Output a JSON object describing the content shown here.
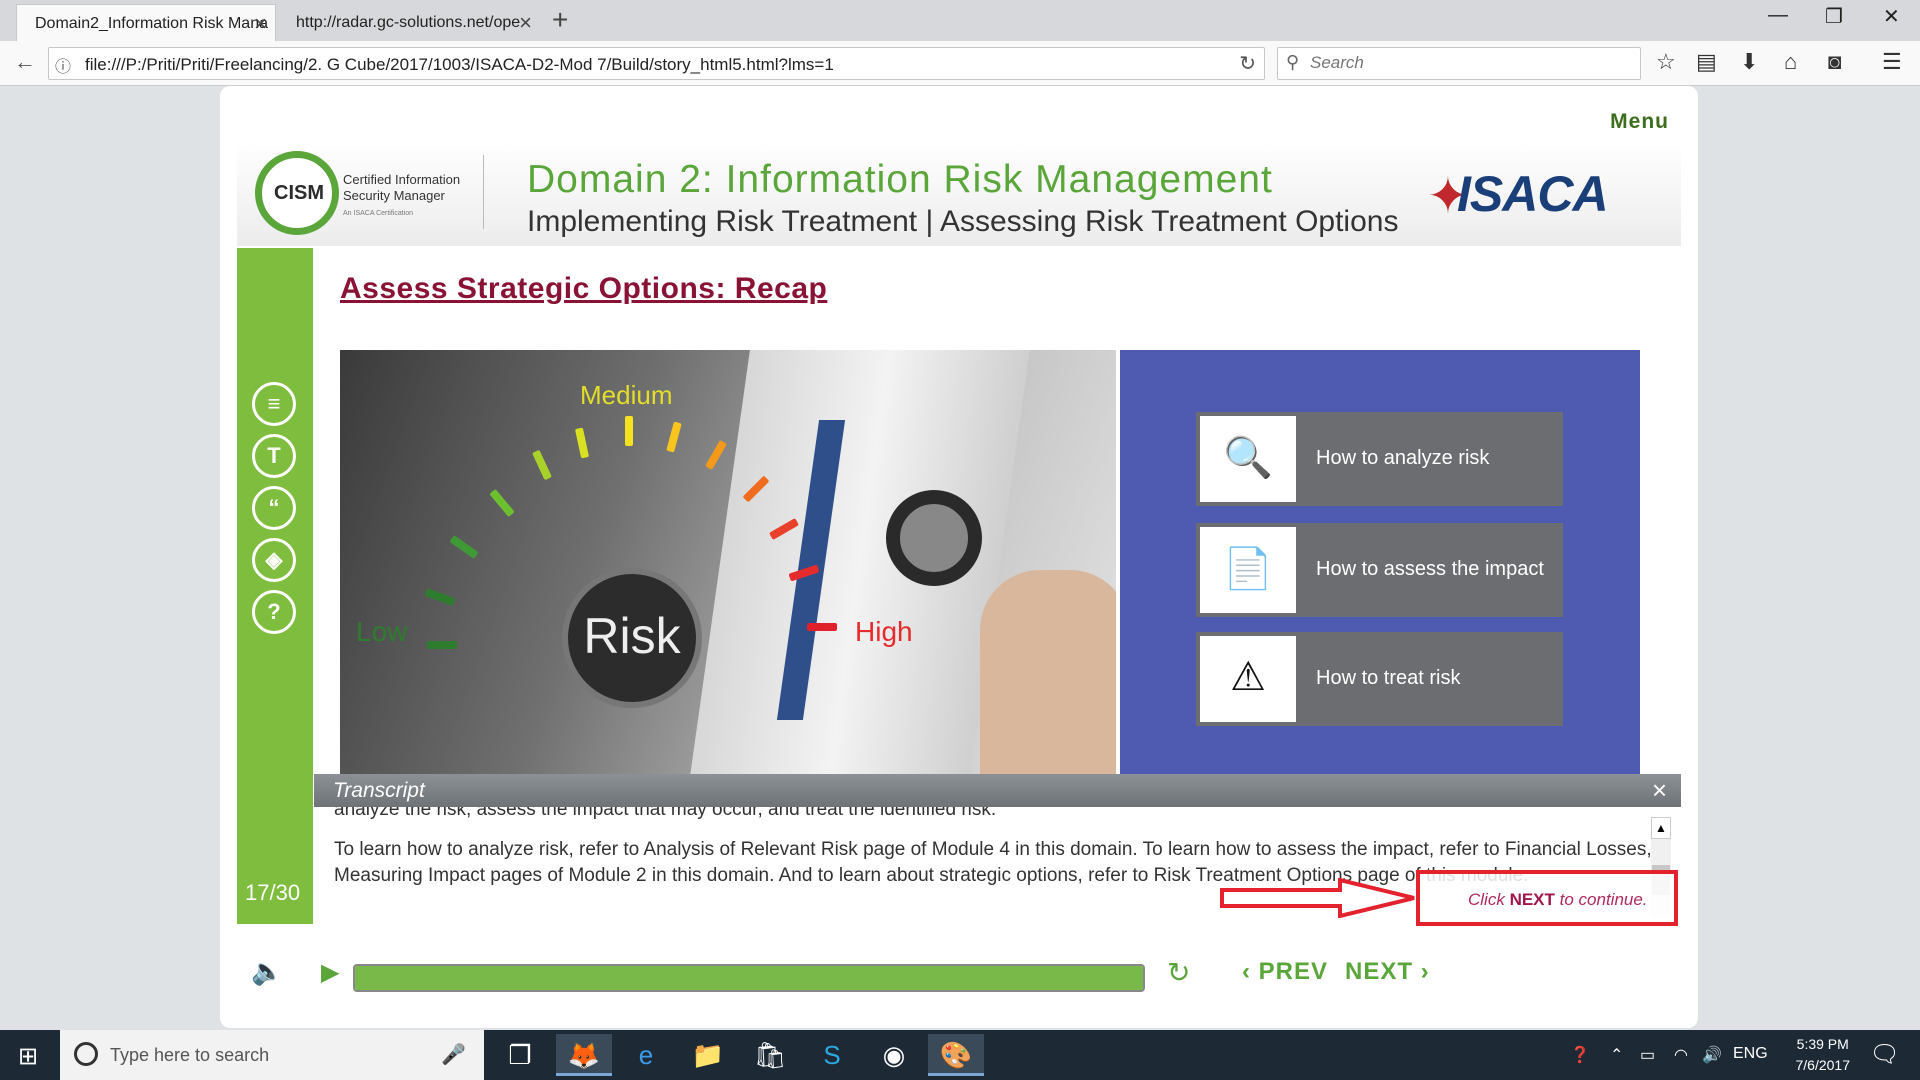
{
  "browser": {
    "tabs": [
      {
        "label": "Domain2_Information Risk Mana",
        "active": true
      },
      {
        "label": "http://radar.gc-solutions.net/ope",
        "active": false
      }
    ],
    "url": "file:///P:/Priti/Priti/Freelancing/2. G Cube/2017/1003/ISACA-D2-Mod 7/Build/story_html5.html?lms=1",
    "search_placeholder": "Search"
  },
  "course": {
    "menu_label": "Menu",
    "logo_text": "CISM",
    "logo_caption": "Certified Information Security Manager",
    "logo_subcaption": "An ISACA Certification",
    "domain_title": "Domain 2: Information Risk Management",
    "domain_subtitle": "Implementing Risk Treatment | Assessing Risk Treatment Options",
    "brand": "ISACA",
    "slide_title": "Assess Strategic Options: Recap",
    "page_count": "17/30",
    "gauge": {
      "low": "Low",
      "medium": "Medium",
      "high": "High",
      "center": "Risk"
    },
    "options": [
      {
        "label": "How to analyze risk",
        "icon": "magnifier-chart-icon"
      },
      {
        "label": "How to assess the impact",
        "icon": "document-magnifier-icon"
      },
      {
        "label": "How to treat risk",
        "icon": "magnifier-warning-icon"
      }
    ],
    "transcript": {
      "title": "Transcript",
      "line_cut": "analyze the risk, assess the impact that may occur, and treat the identified risk.",
      "paragraph": "To learn how to analyze risk, refer to Analysis of Relevant Risk page of Module 4 in this domain. To learn how to assess the impact, refer to Financial Losses, Measuring Impact pages of Module 2 in this domain. And to learn about strategic options, refer to Risk Treatment Options page of this module."
    },
    "callout": {
      "prefix": "Click ",
      "bold": "NEXT",
      "suffix": " to continue."
    },
    "controls": {
      "prev_label": "PREV",
      "next_label": "NEXT",
      "progress": 1.0
    }
  },
  "taskbar": {
    "search_placeholder": "Type here to search",
    "language": "ENG",
    "time": "5:39 PM",
    "date": "7/6/2017"
  },
  "colors": {
    "accent_green": "#7ebd3e",
    "title_maroon": "#8a1235",
    "panel_blue": "#4f5bb0",
    "callout_red": "#e3222e"
  }
}
